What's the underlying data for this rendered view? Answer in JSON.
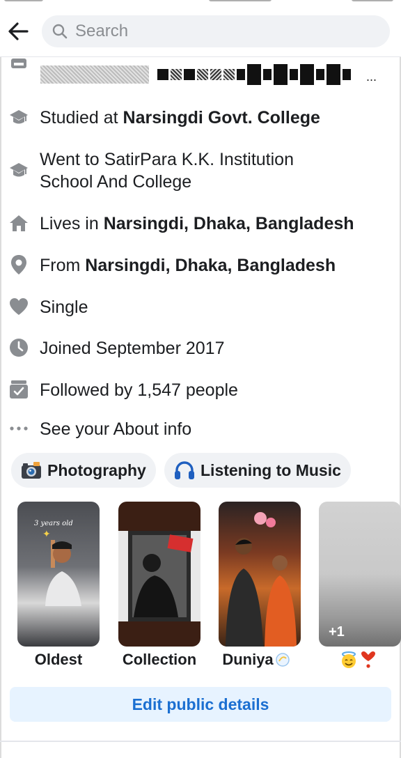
{
  "header": {
    "search_placeholder": "Search"
  },
  "about": {
    "items": [
      {
        "icon": "graduation-cap-icon",
        "prefix": "Studied at ",
        "bold": "Narsingdi Govt. College"
      },
      {
        "icon": "graduation-cap-icon",
        "prefix": "Went to SatirPara K.K. Institution School And College",
        "bold": ""
      },
      {
        "icon": "home-icon",
        "prefix": "Lives in ",
        "bold": "Narsingdi, Dhaka, Bangladesh"
      },
      {
        "icon": "location-pin-icon",
        "prefix": "From ",
        "bold": "Narsingdi, Dhaka, Bangladesh"
      },
      {
        "icon": "heart-icon",
        "prefix": "Single",
        "bold": ""
      },
      {
        "icon": "clock-icon",
        "prefix": "Joined September 2017",
        "bold": ""
      },
      {
        "icon": "followers-icon",
        "prefix": "Followed by 1,547 people",
        "bold": ""
      },
      {
        "icon": "more-dots-icon",
        "prefix": "See your About info",
        "bold": ""
      }
    ]
  },
  "hobbies": [
    {
      "label": "Photography",
      "icon": "camera-icon"
    },
    {
      "label": "Listening to Music",
      "icon": "headphones-icon"
    }
  ],
  "featured": {
    "cards": [
      {
        "label": "Oldest",
        "overlay": "3 years old"
      },
      {
        "label": "Collection",
        "overlay": ""
      },
      {
        "label": "Duniya",
        "overlay": ""
      },
      {
        "label": "",
        "overlay": "+1"
      }
    ]
  },
  "actions": {
    "edit_public_details": "Edit public details"
  },
  "colors": {
    "accent": "#1b6fd1",
    "icon_gray": "#8a8d91",
    "chip_bg": "#f0f2f5",
    "edit_bg": "#e7f3ff"
  }
}
